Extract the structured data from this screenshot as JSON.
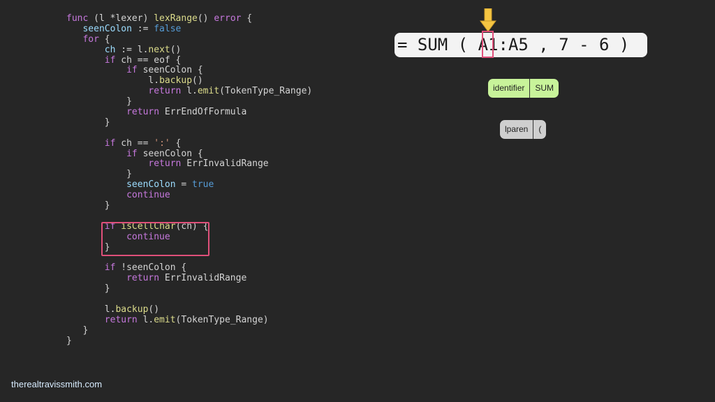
{
  "code_lines": [
    [
      {
        "t": "func ",
        "c": "kw"
      },
      {
        "t": "(l *lexer) ",
        "c": "pl"
      },
      {
        "t": "lexRange",
        "c": "fn"
      },
      {
        "t": "() ",
        "c": "pl"
      },
      {
        "t": "error",
        "c": "kw"
      },
      {
        "t": " {",
        "c": "pl"
      }
    ],
    [
      {
        "t": "   seenColon",
        "c": "vr"
      },
      {
        "t": " := ",
        "c": "pl"
      },
      {
        "t": "false",
        "c": "bl"
      }
    ],
    [
      {
        "t": "   for",
        "c": "kw"
      },
      {
        "t": " {",
        "c": "pl"
      }
    ],
    [
      {
        "t": "       ch",
        "c": "vr"
      },
      {
        "t": " := l.",
        "c": "pl"
      },
      {
        "t": "next",
        "c": "fn"
      },
      {
        "t": "()",
        "c": "pl"
      }
    ],
    [
      {
        "t": "       if",
        "c": "kw"
      },
      {
        "t": " ch == eof {",
        "c": "pl"
      }
    ],
    [
      {
        "t": "           if",
        "c": "kw"
      },
      {
        "t": " seenColon {",
        "c": "pl"
      }
    ],
    [
      {
        "t": "               l.",
        "c": "pl"
      },
      {
        "t": "backup",
        "c": "fn"
      },
      {
        "t": "()",
        "c": "pl"
      }
    ],
    [
      {
        "t": "               return",
        "c": "kw"
      },
      {
        "t": " l.",
        "c": "pl"
      },
      {
        "t": "emit",
        "c": "fn"
      },
      {
        "t": "(TokenType_Range)",
        "c": "pl"
      }
    ],
    [
      {
        "t": "           }",
        "c": "pl"
      }
    ],
    [
      {
        "t": "           return",
        "c": "kw"
      },
      {
        "t": " ErrEndOfFormula",
        "c": "pl"
      }
    ],
    [
      {
        "t": "       }",
        "c": "pl"
      }
    ],
    [
      {
        "t": "",
        "c": "pl"
      }
    ],
    [
      {
        "t": "       if",
        "c": "kw"
      },
      {
        "t": " ch == ",
        "c": "pl"
      },
      {
        "t": "':'",
        "c": "st"
      },
      {
        "t": " {",
        "c": "pl"
      }
    ],
    [
      {
        "t": "           if",
        "c": "kw"
      },
      {
        "t": " seenColon {",
        "c": "pl"
      }
    ],
    [
      {
        "t": "               return",
        "c": "kw"
      },
      {
        "t": " ErrInvalidRange",
        "c": "pl"
      }
    ],
    [
      {
        "t": "           }",
        "c": "pl"
      }
    ],
    [
      {
        "t": "           seenColon",
        "c": "vr"
      },
      {
        "t": " = ",
        "c": "pl"
      },
      {
        "t": "true",
        "c": "bl"
      }
    ],
    [
      {
        "t": "           continue",
        "c": "kw"
      }
    ],
    [
      {
        "t": "       }",
        "c": "pl"
      }
    ],
    [
      {
        "t": "",
        "c": "pl"
      }
    ],
    [
      {
        "t": "       if",
        "c": "kw"
      },
      {
        "t": " ",
        "c": "pl"
      },
      {
        "t": "isCellChar",
        "c": "fn"
      },
      {
        "t": "(ch) {",
        "c": "pl"
      }
    ],
    [
      {
        "t": "           continue",
        "c": "kw"
      }
    ],
    [
      {
        "t": "       }",
        "c": "pl"
      }
    ],
    [
      {
        "t": "",
        "c": "pl"
      }
    ],
    [
      {
        "t": "       if",
        "c": "kw"
      },
      {
        "t": " !seenColon {",
        "c": "pl"
      }
    ],
    [
      {
        "t": "           return",
        "c": "kw"
      },
      {
        "t": " ErrInvalidRange",
        "c": "pl"
      }
    ],
    [
      {
        "t": "       }",
        "c": "pl"
      }
    ],
    [
      {
        "t": "",
        "c": "pl"
      }
    ],
    [
      {
        "t": "       l.",
        "c": "pl"
      },
      {
        "t": "backup",
        "c": "fn"
      },
      {
        "t": "()",
        "c": "pl"
      }
    ],
    [
      {
        "t": "       return",
        "c": "kw"
      },
      {
        "t": " l.",
        "c": "pl"
      },
      {
        "t": "emit",
        "c": "fn"
      },
      {
        "t": "(TokenType_Range)",
        "c": "pl"
      }
    ],
    [
      {
        "t": "   }",
        "c": "pl"
      }
    ],
    [
      {
        "t": "}",
        "c": "pl"
      }
    ]
  ],
  "formula": "= SUM ( A1:A5 , 7 - 6 )",
  "tokens": {
    "identifier": {
      "type": "identifier",
      "value": "SUM"
    },
    "lparen": {
      "type": "lparen",
      "value": "("
    }
  },
  "footer": "therealtravissmith.com",
  "colors": {
    "highlight": "#e0507a",
    "arrow": "#f5c542",
    "identifier_token": "#c8f39a",
    "lparen_token": "#cfcfcf"
  },
  "icons": {
    "pointer": "arrow-down-icon"
  }
}
